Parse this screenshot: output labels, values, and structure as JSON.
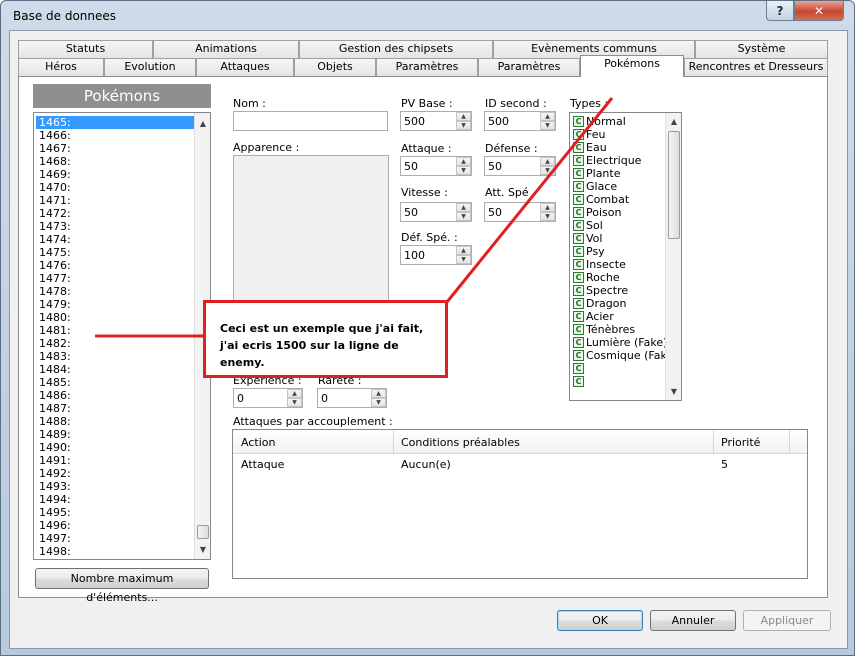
{
  "window": {
    "title": "Base de donnees",
    "help_label": "?",
    "close_label": "✕"
  },
  "tabs": {
    "row1": [
      "Statuts",
      "Animations",
      "Gestion des chipsets",
      "Evènements communs",
      "Système"
    ],
    "row2": [
      "Héros",
      "Evolution",
      "Attaques",
      "Objets",
      "Paramètres",
      "Paramètres",
      "Pokémons",
      "Rencontres et Dresseurs"
    ],
    "active": "Pokémons"
  },
  "list": {
    "header": "Pokémons",
    "items": [
      "1465:",
      "1466:",
      "1467:",
      "1468:",
      "1469:",
      "1470:",
      "1471:",
      "1472:",
      "1473:",
      "1474:",
      "1475:",
      "1476:",
      "1477:",
      "1478:",
      "1479:",
      "1480:",
      "1481:",
      "1482:",
      "1483:",
      "1484:",
      "1485:",
      "1486:",
      "1487:",
      "1488:",
      "1489:",
      "1490:",
      "1491:",
      "1492:",
      "1493:",
      "1494:",
      "1495:",
      "1496:",
      "1497:",
      "1498:"
    ],
    "selected_index": 0,
    "max_button": "Nombre maximum d'éléments..."
  },
  "form": {
    "nom_label": "Nom :",
    "nom_value": "",
    "apparence_label": "Apparence :",
    "pv_label": "PV Base :",
    "pv_value": "500",
    "id_label": "ID second :",
    "id_value": "500",
    "attaque_label": "Attaque :",
    "attaque_value": "50",
    "defense_label": "Défense :",
    "defense_value": "50",
    "vitesse_label": "Vitesse :",
    "vitesse_value": "50",
    "attspe_label": "Att. Spé",
    "attspe_value": "50",
    "defspe_label": "Déf. Spé. :",
    "defspe_value": "100",
    "types_label": "Types :",
    "experience_label": "Experience :",
    "experience_value": "0",
    "rarete_label": "Rareté :",
    "rarete_value": "0"
  },
  "types": [
    "Normal",
    "Feu",
    "Eau",
    "Electrique",
    "Plante",
    "Glace",
    "Combat",
    "Poison",
    "Sol",
    "Vol",
    "Psy",
    "Insecte",
    "Roche",
    "Spectre",
    "Dragon",
    "Acier",
    "Ténèbres",
    "Lumière (Fake)",
    "Cosmique (Fake",
    "",
    ""
  ],
  "attacks": {
    "title": "Attaques par accouplement :",
    "columns": [
      "Action",
      "Conditions préalables",
      "Priorité"
    ],
    "rows": [
      [
        "Attaque",
        "Aucun(e)",
        "5"
      ]
    ]
  },
  "buttons": {
    "ok": "OK",
    "cancel": "Annuler",
    "apply": "Appliquer"
  },
  "annotation": {
    "text": "Ceci est un exemple que j'ai fait, j'ai ecris 1500 sur la ligne de enemy.",
    "color": "#e02020"
  }
}
